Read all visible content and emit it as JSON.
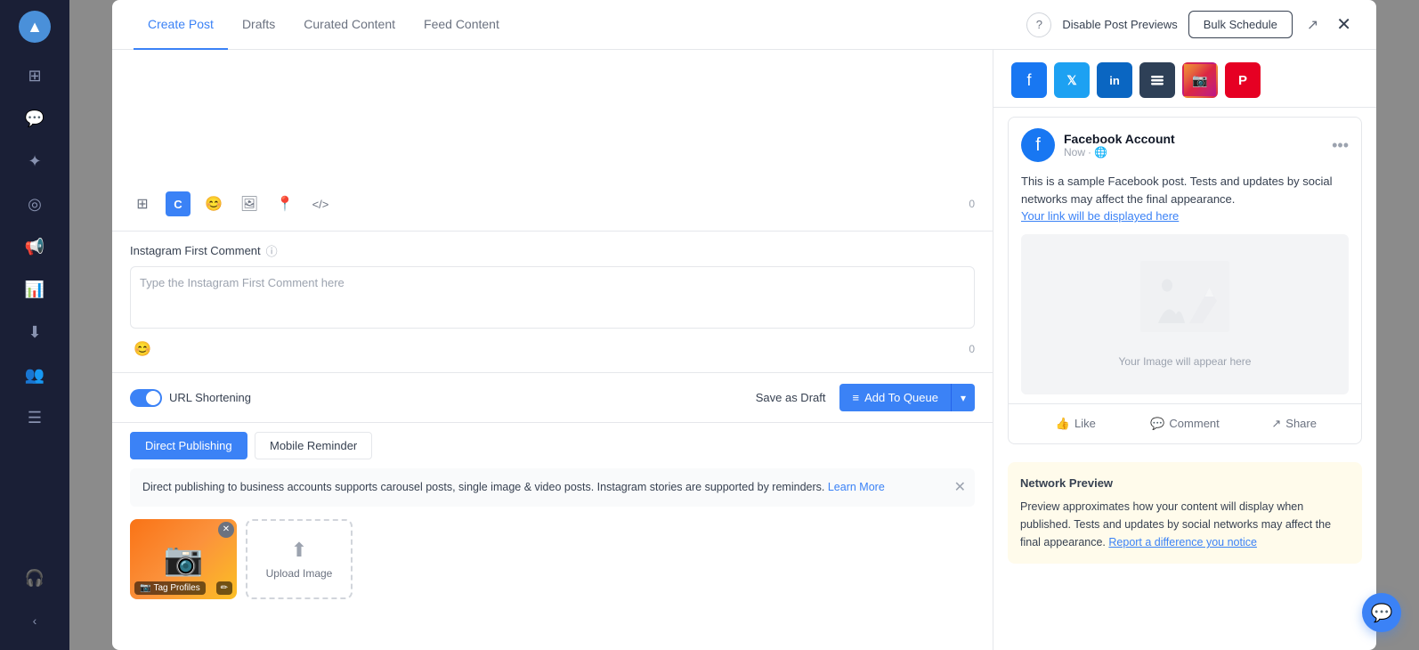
{
  "sidebar": {
    "logo_icon": "▲",
    "items": [
      {
        "id": "dashboard",
        "icon": "⊞",
        "label": "Dashboard"
      },
      {
        "id": "messages",
        "icon": "💬",
        "label": "Messages"
      },
      {
        "id": "analytics",
        "icon": "✦",
        "label": "Analytics"
      },
      {
        "id": "monitor",
        "icon": "◎",
        "label": "Monitor"
      },
      {
        "id": "campaigns",
        "icon": "📢",
        "label": "Campaigns"
      },
      {
        "id": "reports",
        "icon": "📊",
        "label": "Reports"
      },
      {
        "id": "import",
        "icon": "⬇",
        "label": "Import"
      },
      {
        "id": "users",
        "icon": "👥",
        "label": "Users"
      },
      {
        "id": "feeds",
        "icon": "☰",
        "label": "Feeds"
      },
      {
        "id": "support",
        "icon": "🎧",
        "label": "Support"
      }
    ],
    "collapse_icon": "‹"
  },
  "modal": {
    "tabs": [
      {
        "id": "create-post",
        "label": "Create Post",
        "active": true
      },
      {
        "id": "drafts",
        "label": "Drafts",
        "active": false
      },
      {
        "id": "curated-content",
        "label": "Curated Content",
        "active": false
      },
      {
        "id": "feed-content",
        "label": "Feed Content",
        "active": false
      }
    ],
    "header_actions": {
      "help_label": "?",
      "disable_preview_label": "Disable Post Previews",
      "bulk_schedule_label": "Bulk Schedule"
    },
    "post_textarea": {
      "placeholder": "",
      "value": "",
      "char_count": "0"
    },
    "toolbar": {
      "icons": [
        {
          "id": "template",
          "symbol": "⊞"
        },
        {
          "id": "content",
          "symbol": "C"
        },
        {
          "id": "emoji",
          "symbol": "😊"
        },
        {
          "id": "media",
          "symbol": "🖼"
        },
        {
          "id": "location",
          "symbol": "📍"
        },
        {
          "id": "code",
          "symbol": "</>"
        }
      ]
    },
    "instagram_comment": {
      "label": "Instagram First Comment",
      "placeholder": "Type the Instagram First Comment here",
      "char_count": "0"
    },
    "url_shortening": {
      "label": "URL Shortening",
      "enabled": true
    },
    "buttons": {
      "save_draft": "Save as Draft",
      "add_to_queue": "Add To Queue",
      "dropdown_icon": "▾",
      "queue_icon": "≡"
    },
    "publishing_tabs": [
      {
        "id": "direct",
        "label": "Direct Publishing",
        "active": true
      },
      {
        "id": "reminder",
        "label": "Mobile Reminder",
        "active": false
      }
    ],
    "info_banner": {
      "text": "Direct publishing to business accounts supports carousel posts, single image & video posts. Instagram stories are supported by reminders.",
      "link_label": "Learn More",
      "link_url": "#"
    },
    "media": {
      "tag_label": "Tag Profiles",
      "upload_label": "Upload Image",
      "upload_icon": "⬆"
    }
  },
  "preview": {
    "social_icons": [
      {
        "id": "facebook",
        "platform": "facebook",
        "symbol": "f"
      },
      {
        "id": "twitter",
        "platform": "twitter",
        "symbol": "𝕏"
      },
      {
        "id": "linkedin",
        "platform": "linkedin",
        "symbol": "in"
      },
      {
        "id": "buffer",
        "platform": "buffer",
        "symbol": "B"
      },
      {
        "id": "instagram",
        "platform": "instagram",
        "symbol": "📷"
      },
      {
        "id": "pinterest",
        "platform": "pinterest",
        "symbol": "P"
      }
    ],
    "account_name": "Facebook Account",
    "post_time": "Now",
    "globe_icon": "🌐",
    "more_icon": "•••",
    "post_text": "This is a sample Facebook post. Tests and updates by social networks may affect the final appearance.",
    "link_text": "Your link will be displayed here",
    "image_placeholder": "Your Image will appear here",
    "actions": [
      {
        "id": "like",
        "icon": "👍",
        "label": "Like"
      },
      {
        "id": "comment",
        "icon": "💬",
        "label": "Comment"
      },
      {
        "id": "share",
        "icon": "↗",
        "label": "Share"
      }
    ],
    "network_preview": {
      "title": "Network Preview",
      "text": "Preview approximates how your content will display when published. Tests and updates by social networks may affect the final appearance.",
      "link_label": "Report a difference you notice",
      "link_url": "#"
    }
  },
  "chat_bubble": {
    "icon": "💬"
  }
}
